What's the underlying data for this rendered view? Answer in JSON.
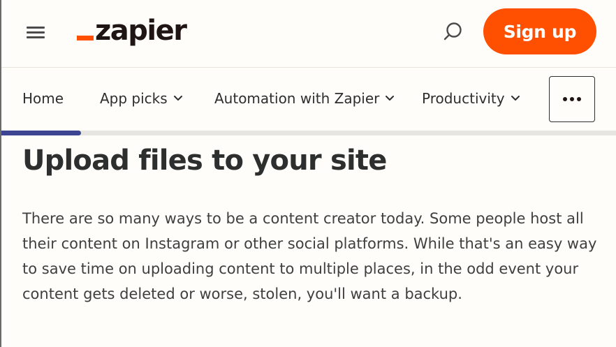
{
  "header": {
    "menu_icon": "hamburger-menu-icon",
    "logo": "zapier",
    "search_icon": "search-icon",
    "signup_label": "Sign up",
    "accent_color": "#ff4f00"
  },
  "nav": {
    "items": [
      {
        "label": "Home",
        "has_dropdown": false
      },
      {
        "label": "App picks",
        "has_dropdown": true
      },
      {
        "label": "Automation with Zapier",
        "has_dropdown": true
      },
      {
        "label": "Productivity",
        "has_dropdown": true
      }
    ],
    "more_icon": "more-horizontal-icon"
  },
  "progress": {
    "fraction": 0.13,
    "color": "#3d4592"
  },
  "article": {
    "title": "Upload files to your site",
    "body": "There are so many ways to be a content creator today. Some people host all their content on Instagram or other social platforms. While that's an easy way to save time on uploading content to multiple places, in the odd event your content gets deleted or worse, stolen, you'll want a backup."
  }
}
